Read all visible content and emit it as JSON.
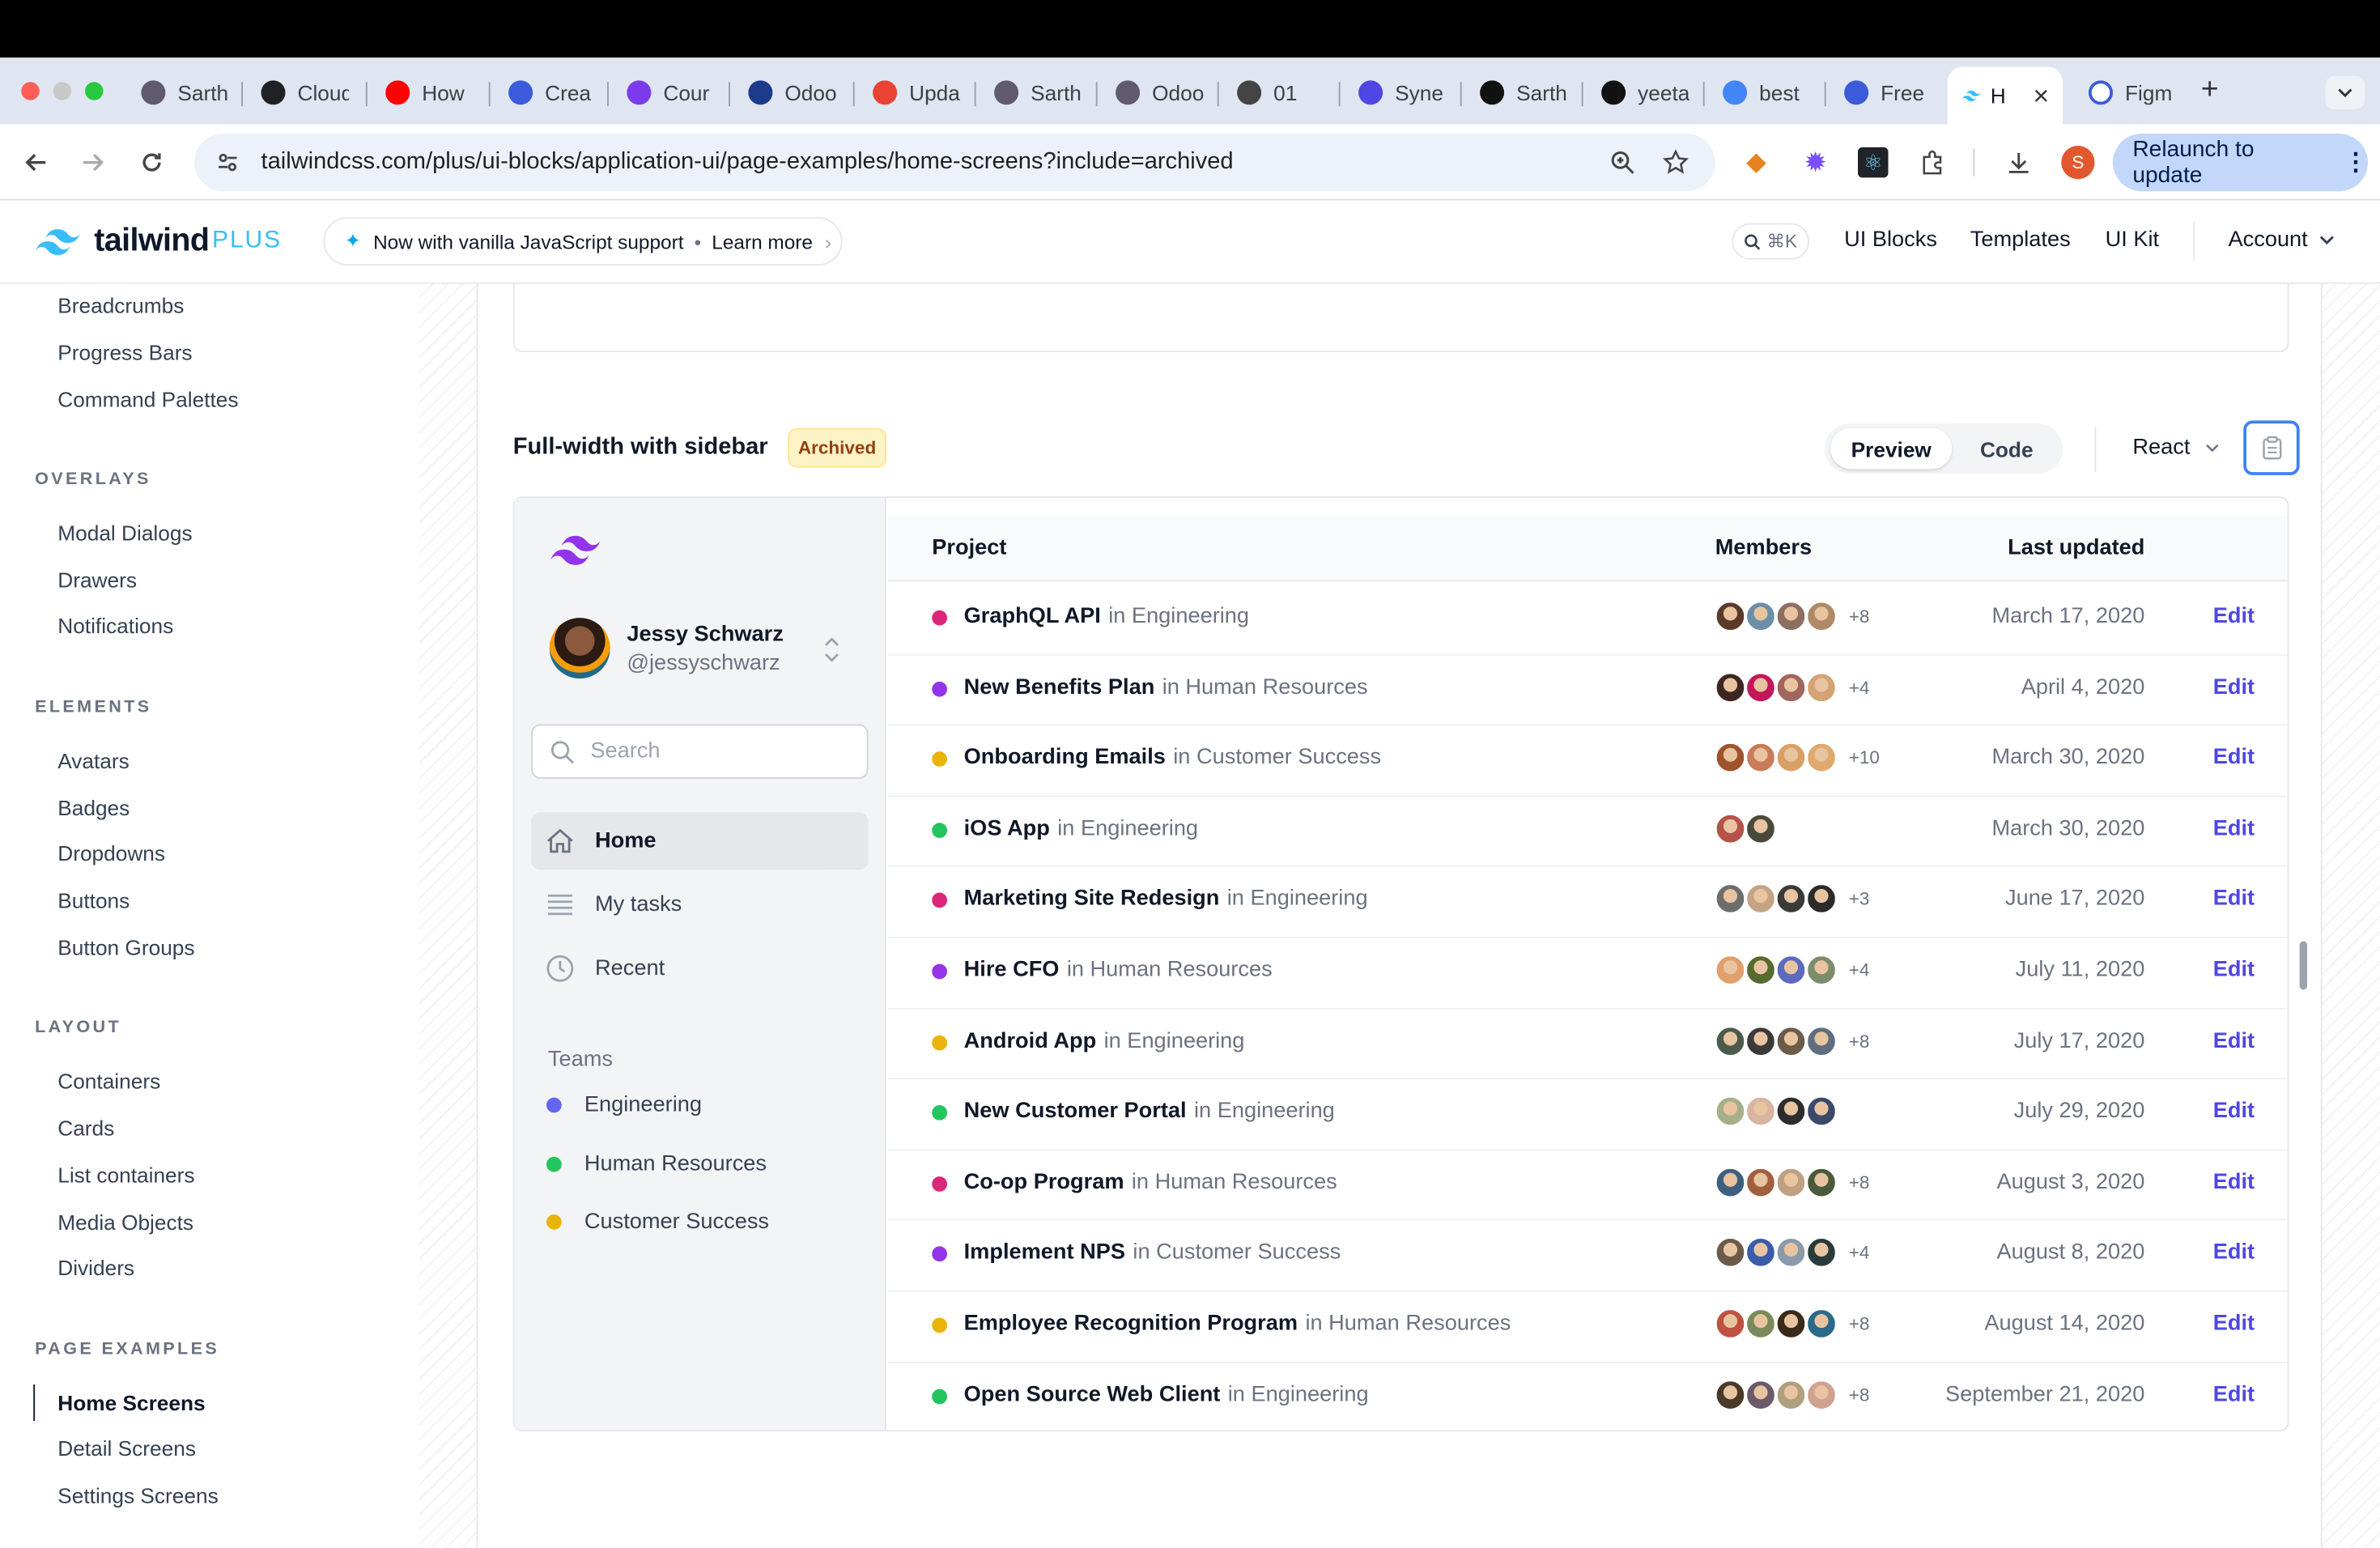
{
  "browser": {
    "tabs": [
      {
        "label": "Sarth",
        "icon": "circle-logo-icon",
        "color": "#5f5a6e"
      },
      {
        "label": "Cloud",
        "icon": "openai-icon",
        "color": "#202124"
      },
      {
        "label": "How",
        "icon": "youtube-icon",
        "color": "#ff0000"
      },
      {
        "label": "Crea",
        "icon": "grid-icon",
        "color": "#3b5bdb"
      },
      {
        "label": "Cour",
        "icon": "u-logo-icon",
        "color": "#7c3aed"
      },
      {
        "label": "Odoo",
        "icon": "un-logo-icon",
        "color": "#1e3a8a"
      },
      {
        "label": "Upda",
        "icon": "gmail-icon",
        "color": "#ea4335"
      },
      {
        "label": "Sarth",
        "icon": "circle-logo-icon",
        "color": "#5f5a6e"
      },
      {
        "label": "Odoo",
        "icon": "circle-logo-icon",
        "color": "#5f5a6e"
      },
      {
        "label": "01",
        "icon": "globe-icon",
        "color": "#444"
      },
      {
        "label": "Syne",
        "icon": "cross-logo-icon",
        "color": "#4f46e5"
      },
      {
        "label": "Sarth",
        "icon": "github-icon",
        "color": "#111"
      },
      {
        "label": "yeeta",
        "icon": "github-icon",
        "color": "#111"
      },
      {
        "label": "best",
        "icon": "google-icon",
        "color": "#4285f4"
      },
      {
        "label": "Free",
        "icon": "bars-icon",
        "color": "#3b5bdb"
      }
    ],
    "active_tab": {
      "label": "H",
      "close": "×"
    },
    "tab_after": {
      "label": "Figm"
    },
    "new_tab": "+",
    "url": "tailwindcss.com/plus/ui-blocks/application-ui/page-examples/home-screens?include=archived",
    "relaunch": "Relaunch to update",
    "profile_initial": "S"
  },
  "site": {
    "brand": "tailwind",
    "brand_suffix": "PLUS",
    "announcement": "Now with vanilla JavaScript support",
    "announcement_sep": "•",
    "learn_more": "Learn more",
    "search_kbd": "⌘K",
    "nav": [
      "UI Blocks",
      "Templates",
      "UI Kit"
    ],
    "account": "Account"
  },
  "sidebar": {
    "top_items": [
      "Breadcrumbs",
      "Progress Bars",
      "Command Palettes"
    ],
    "overlays_head": "OVERLAYS",
    "overlays": [
      "Modal Dialogs",
      "Drawers",
      "Notifications"
    ],
    "elements_head": "ELEMENTS",
    "elements": [
      "Avatars",
      "Badges",
      "Dropdowns",
      "Buttons",
      "Button Groups"
    ],
    "layout_head": "LAYOUT",
    "layout": [
      "Containers",
      "Cards",
      "List containers",
      "Media Objects",
      "Dividers"
    ],
    "page_examples_head": "PAGE EXAMPLES",
    "page_examples": [
      "Home Screens",
      "Detail Screens",
      "Settings Screens"
    ]
  },
  "example": {
    "title": "Full-width with sidebar",
    "badge": "Archived",
    "preview": "Preview",
    "code": "Code",
    "framework": "React"
  },
  "preview": {
    "user_name": "Jessy Schwarz",
    "user_handle": "@jessyschwarz",
    "search_placeholder": "Search",
    "nav": [
      "Home",
      "My tasks",
      "Recent"
    ],
    "teams_label": "Teams",
    "teams": [
      {
        "name": "Engineering",
        "color": "#6366f1"
      },
      {
        "name": "Human Resources",
        "color": "#22c55e"
      },
      {
        "name": "Customer Success",
        "color": "#eab308"
      }
    ],
    "columns": {
      "project": "Project",
      "members": "Members",
      "updated": "Last updated"
    },
    "edit_label": "Edit",
    "rows": [
      {
        "name": "GraphQL API",
        "team": "in Engineering",
        "color": "#db2777",
        "more": "+8",
        "date": "March 17, 2020"
      },
      {
        "name": "New Benefits Plan",
        "team": "in Human Resources",
        "color": "#9333ea",
        "more": "+4",
        "date": "April 4, 2020"
      },
      {
        "name": "Onboarding Emails",
        "team": "in Customer Success",
        "color": "#eab308",
        "more": "+10",
        "date": "March 30, 2020"
      },
      {
        "name": "iOS App",
        "team": "in Engineering",
        "color": "#22c55e",
        "more": "",
        "date": "March 30, 2020"
      },
      {
        "name": "Marketing Site Redesign",
        "team": "in Engineering",
        "color": "#db2777",
        "more": "+3",
        "date": "June 17, 2020"
      },
      {
        "name": "Hire CFO",
        "team": "in Human Resources",
        "color": "#9333ea",
        "more": "+4",
        "date": "July 11, 2020"
      },
      {
        "name": "Android App",
        "team": "in Engineering",
        "color": "#eab308",
        "more": "+8",
        "date": "July 17, 2020"
      },
      {
        "name": "New Customer Portal",
        "team": "in Engineering",
        "color": "#22c55e",
        "more": "",
        "date": "July 29, 2020"
      },
      {
        "name": "Co-op Program",
        "team": "in Human Resources",
        "color": "#db2777",
        "more": "+8",
        "date": "August 3, 2020"
      },
      {
        "name": "Implement NPS",
        "team": "in Customer Success",
        "color": "#9333ea",
        "more": "+4",
        "date": "August 8, 2020"
      },
      {
        "name": "Employee Recognition Program",
        "team": "in Human Resources",
        "color": "#eab308",
        "more": "+8",
        "date": "August 14, 2020"
      },
      {
        "name": "Open Source Web Client",
        "team": "in Engineering",
        "color": "#22c55e",
        "more": "+8",
        "date": "September 21, 2020"
      }
    ]
  }
}
